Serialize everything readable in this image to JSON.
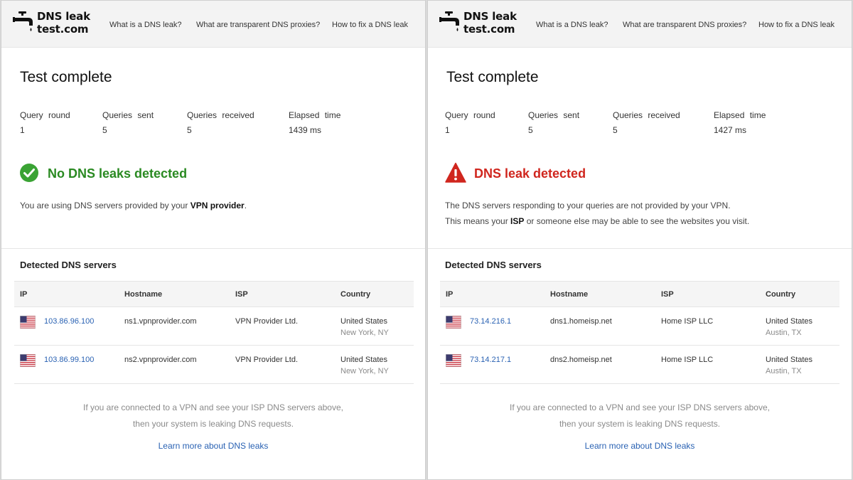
{
  "site": {
    "logo_line1": "DNS leak",
    "logo_line2": "test.com",
    "nav": [
      "What is a DNS leak?",
      "What are transparent DNS proxies?",
      "How to fix a DNS leak"
    ]
  },
  "colors": {
    "ok": "#2a8a22",
    "bad": "#d0261e",
    "link": "#2a62b3"
  },
  "stat_labels": [
    "Query round",
    "Queries sent",
    "Queries received",
    "Elapsed time"
  ],
  "table_headers": [
    "IP",
    "Hostname",
    "ISP",
    "Country"
  ],
  "left": {
    "title": "Test complete",
    "stats": [
      "1",
      "5",
      "5",
      "1439 ms"
    ],
    "result_icon": "check-circle-icon",
    "result_title": "No DNS leaks detected",
    "message": {
      "pre": "You are using DNS servers provided by your ",
      "strong": "VPN provider",
      "post": "."
    },
    "section_title": "Detected DNS servers",
    "servers": [
      {
        "flag": "us-flag-icon",
        "ip": "103.86.96.100",
        "hostname": "ns1.vpnprovider.com",
        "isp": "VPN Provider Ltd.",
        "country": "United States",
        "city": "New York, NY"
      },
      {
        "flag": "us-flag-icon",
        "ip": "103.86.99.100",
        "hostname": "ns2.vpnprovider.com",
        "isp": "VPN Provider Ltd.",
        "country": "United States",
        "city": "New York, NY"
      }
    ],
    "footer_line1": "If you are connected to a VPN and see your ISP DNS servers above,",
    "footer_line2": "then your system is leaking DNS requests.",
    "footer_link": "Learn more about DNS leaks"
  },
  "right": {
    "title": "Test complete",
    "stats": [
      "1",
      "5",
      "5",
      "1427 ms"
    ],
    "result_icon": "warning-triangle-icon",
    "result_title": "DNS leak detected",
    "message_line1": "The DNS servers responding to your queries are not provided by your VPN.",
    "message_line2": {
      "pre": "This means your ",
      "strong": "ISP",
      "post": " or someone else may be able to see the websites you visit."
    },
    "section_title": "Detected DNS servers",
    "servers": [
      {
        "flag": "us-flag-icon",
        "ip": "73.14.216.1",
        "hostname": "dns1.homeisp.net",
        "isp": "Home ISP LLC",
        "country": "United States",
        "city": "Austin, TX"
      },
      {
        "flag": "us-flag-icon",
        "ip": "73.14.217.1",
        "hostname": "dns2.homeisp.net",
        "isp": "Home ISP LLC",
        "country": "United States",
        "city": "Austin, TX"
      }
    ],
    "footer_line1": "If you are connected to a VPN and see your ISP DNS servers above,",
    "footer_line2": "then your system is leaking DNS requests.",
    "footer_link": "Learn more about DNS leaks"
  }
}
